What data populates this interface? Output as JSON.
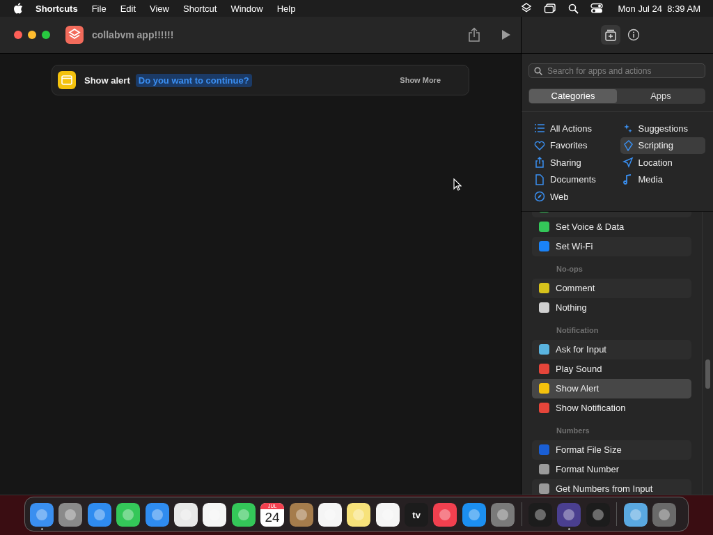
{
  "menu_bar": {
    "app": "Shortcuts",
    "menus": [
      "File",
      "Edit",
      "View",
      "Shortcut",
      "Window",
      "Help"
    ],
    "clock": "Mon Jul 24  8:39 AM"
  },
  "window": {
    "title": "collabvm app!!!!!!"
  },
  "action": {
    "name": "Show alert",
    "message": "Do you want to continue?",
    "more": "Show More"
  },
  "sidebar": {
    "search": {
      "placeholder": "Search for apps and actions"
    },
    "segments": [
      {
        "label": "Categories",
        "selected": true
      },
      {
        "label": "Apps",
        "selected": false
      }
    ],
    "categories": [
      {
        "label": "All Actions",
        "selected": false
      },
      {
        "label": "Favorites",
        "selected": false
      },
      {
        "label": "Sharing",
        "selected": false
      },
      {
        "label": "Documents",
        "selected": false
      },
      {
        "label": "Web",
        "selected": false
      },
      {
        "label": "Suggestions",
        "selected": false
      },
      {
        "label": "Scripting",
        "selected": true
      },
      {
        "label": "Location",
        "selected": false
      },
      {
        "label": "Media",
        "selected": false
      }
    ],
    "actions": [
      {
        "kind": "action",
        "color": "#34c759",
        "selected": false
      },
      {
        "kind": "action",
        "label": "Set Voice & Data",
        "color": "#34c759",
        "selected": false
      },
      {
        "kind": "action",
        "label": "Set Wi-Fi",
        "color": "#1a82f7",
        "selected": false
      },
      {
        "kind": "header",
        "label": "No-ops"
      },
      {
        "kind": "action",
        "label": "Comment",
        "color": "#d6c21c",
        "selected": false
      },
      {
        "kind": "action",
        "label": "Nothing",
        "color": "#d0d0d0",
        "selected": false
      },
      {
        "kind": "header",
        "label": "Notification"
      },
      {
        "kind": "action",
        "label": "Ask for Input",
        "color": "#5ab4e0",
        "selected": false
      },
      {
        "kind": "action",
        "label": "Play Sound",
        "color": "#e5453a",
        "selected": false
      },
      {
        "kind": "action",
        "label": "Show Alert",
        "color": "#f4c20d",
        "selected": true
      },
      {
        "kind": "action",
        "label": "Show Notification",
        "color": "#e5453a",
        "selected": false
      },
      {
        "kind": "header",
        "label": "Numbers"
      },
      {
        "kind": "action",
        "label": "Format File Size",
        "color": "#1a5fd6",
        "selected": false
      },
      {
        "kind": "action",
        "label": "Format Number",
        "color": "#9a9a9a",
        "selected": false
      },
      {
        "kind": "action",
        "label": "Get Numbers from Input",
        "color": "#9a9a9a",
        "selected": false
      }
    ]
  },
  "dock": [
    {
      "color": "#3a8ff0",
      "running": true
    },
    {
      "color": "#8a8a8a",
      "running": false
    },
    {
      "color": "#2f8cf0",
      "running": false
    },
    {
      "color": "#34c759",
      "running": false
    },
    {
      "color": "#2f8cf0",
      "running": false
    },
    {
      "color": "#e8e8e8",
      "running": false
    },
    {
      "color": "#f5f5f5",
      "running": false
    },
    {
      "color": "#34c759",
      "running": false
    },
    {
      "kind": "calendar",
      "color": "#ffffff",
      "month": "JUL",
      "day": "24",
      "running": false
    },
    {
      "color": "#a57c4c",
      "running": false
    },
    {
      "color": "#f5f5f5",
      "running": false
    },
    {
      "color": "#f7e27a",
      "running": false
    },
    {
      "color": "#f5f5f5",
      "running": false
    },
    {
      "kind": "tv",
      "color": "#1c1c1c",
      "text": "tv",
      "running": false
    },
    {
      "color": "#f2404f",
      "running": false
    },
    {
      "color": "#1c8ff0",
      "running": false
    },
    {
      "color": "#7a7a7a",
      "running": false
    },
    {
      "kind": "divider"
    },
    {
      "color": "#1c1c1c",
      "running": false
    },
    {
      "color": "#4a3f8f",
      "running": true
    },
    {
      "color": "#1c1c1c",
      "running": false
    },
    {
      "kind": "divider"
    },
    {
      "color": "#5aa8e0",
      "running": false
    },
    {
      "color": "#6a6a6a",
      "running": false
    }
  ]
}
